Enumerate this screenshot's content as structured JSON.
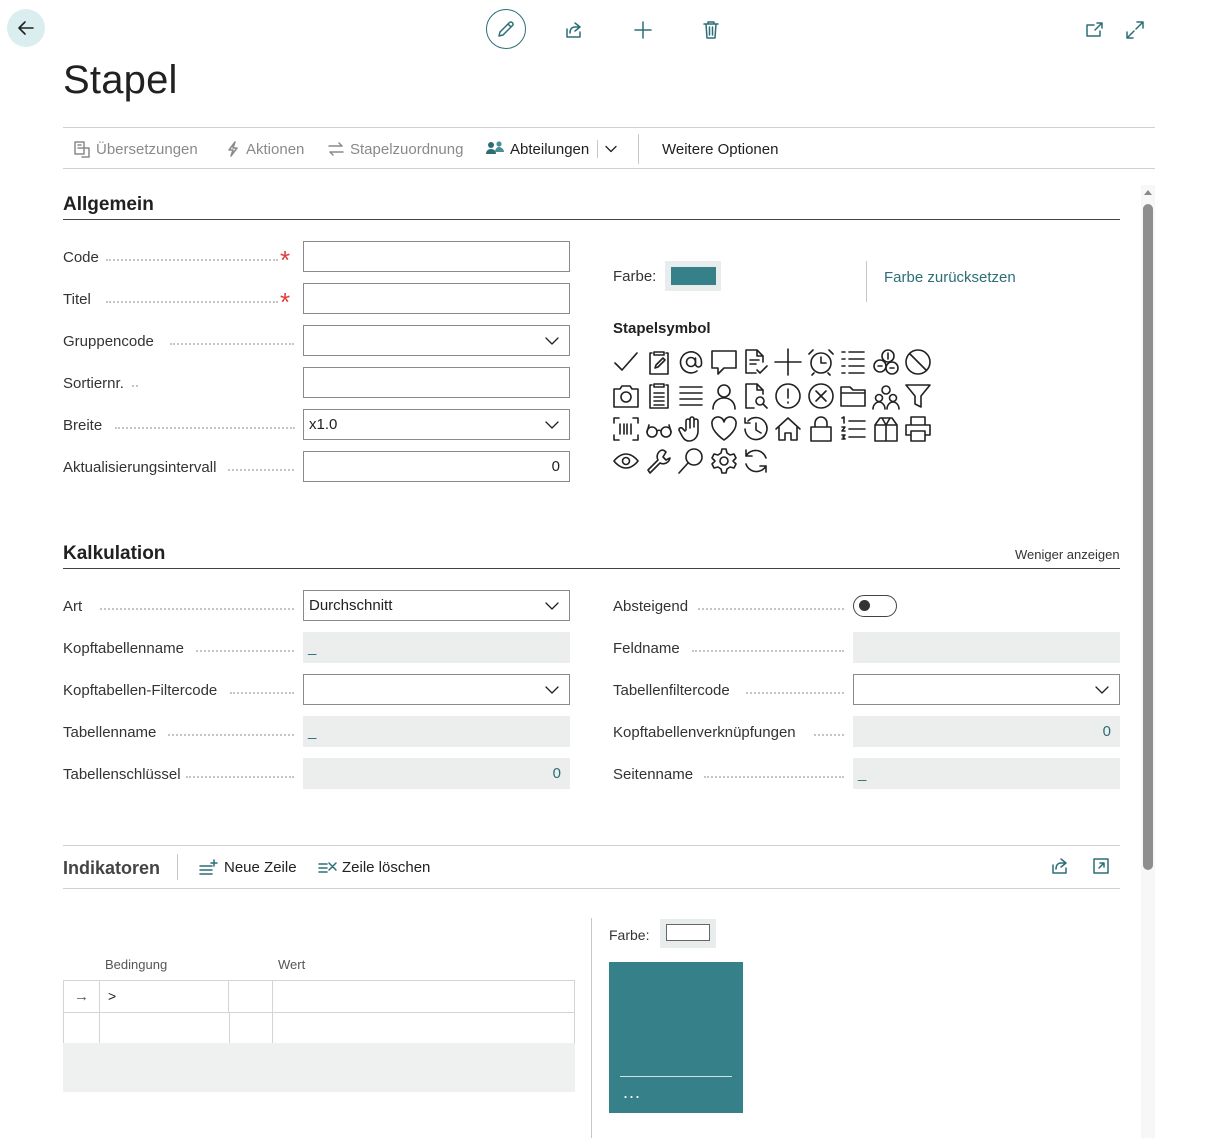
{
  "page_title": "Stapel",
  "actions": {
    "uebersetzungen": "Übersetzungen",
    "aktionen": "Aktionen",
    "stapelzuordnung": "Stapelzuordnung",
    "abteilungen": "Abteilungen",
    "weitere_optionen": "Weitere Optionen"
  },
  "allgemein": {
    "title": "Allgemein",
    "fields": {
      "code": {
        "label": "Code",
        "value": ""
      },
      "titel": {
        "label": "Titel",
        "value": ""
      },
      "gruppencode": {
        "label": "Gruppencode",
        "value": ""
      },
      "sortiernr": {
        "label": "Sortiernr.",
        "value": ""
      },
      "breite": {
        "label": "Breite",
        "value": "x1.0"
      },
      "aktualisierungsintervall": {
        "label": "Aktualisierungsintervall",
        "value": "0"
      }
    },
    "farbe_label": "Farbe:",
    "farbe_color": "#368189",
    "farbe_reset": "Farbe zurücksetzen",
    "stapelsymbol_label": "Stapelsymbol",
    "symbols": [
      "check-icon",
      "clipboard-edit-icon",
      "at-icon",
      "comment-icon",
      "document-check-icon",
      "plus-icon",
      "alarm-clock-icon",
      "list-icon",
      "coins-icon",
      "block-icon",
      "camera-icon",
      "clipboard-list-icon",
      "lines-icon",
      "person-icon",
      "document-search-icon",
      "alert-icon",
      "cancel-icon",
      "folder-icon",
      "group-icon",
      "filter-icon",
      "barcode-icon",
      "glasses-icon",
      "hand-icon",
      "heart-icon",
      "history-icon",
      "home-icon",
      "lock-icon",
      "numbered-list-icon",
      "box-icon",
      "printer-icon",
      "eye-icon",
      "wrench-icon",
      "search-icon",
      "settings-icon",
      "refresh-icon"
    ]
  },
  "kalkulation": {
    "title": "Kalkulation",
    "weniger_anzeigen": "Weniger anzeigen",
    "left": {
      "art": {
        "label": "Art",
        "value": "Durchschnitt"
      },
      "kopftabellenname": {
        "label": "Kopftabellenname",
        "value": "_"
      },
      "kopftabellen_filtercode": {
        "label": "Kopftabellen-Filtercode",
        "value": ""
      },
      "tabellenname": {
        "label": "Tabellenname",
        "value": "_"
      },
      "tabellenschluessel": {
        "label": "Tabellenschlüssel",
        "value": "0"
      }
    },
    "right": {
      "absteigend": {
        "label": "Absteigend",
        "value": false
      },
      "feldname": {
        "label": "Feldname",
        "value": ""
      },
      "tabellenfiltercode": {
        "label": "Tabellenfiltercode",
        "value": ""
      },
      "kopftabellenverknuepfungen": {
        "label": "Kopftabellenverknüpfungen",
        "value": "0"
      },
      "seitenname": {
        "label": "Seitenname",
        "value": "_"
      }
    }
  },
  "indikatoren": {
    "title": "Indikatoren",
    "neue_zeile": "Neue Zeile",
    "zeile_loeschen": "Zeile löschen",
    "columns": [
      "Bedingung",
      "Wert"
    ],
    "rows": [
      {
        "marker": "→",
        "bedingung": ">",
        "wert": ""
      },
      {
        "marker": "",
        "bedingung": "",
        "wert": ""
      }
    ],
    "farbe_label": "Farbe:",
    "tile_color": "#368189",
    "tile_more": "..."
  }
}
